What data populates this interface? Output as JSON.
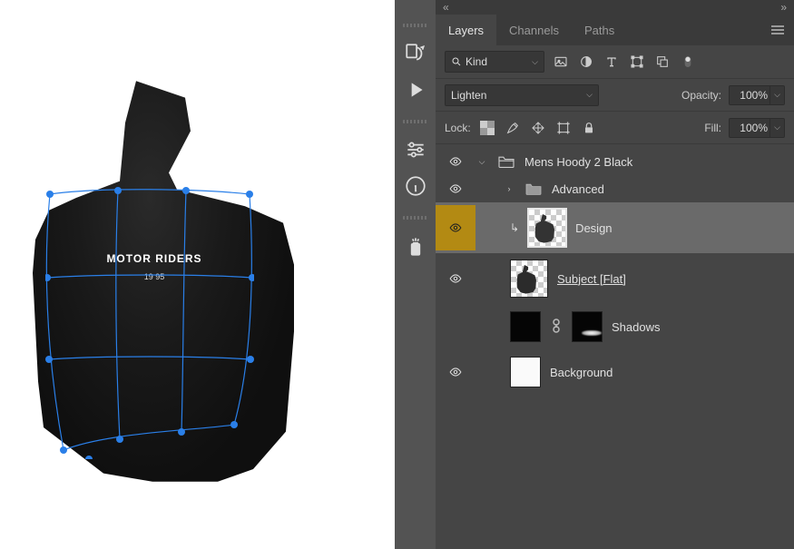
{
  "canvas": {
    "design_headline": "MOTOR RIDERS",
    "design_sub": "19   95"
  },
  "panel": {
    "tabs": [
      "Layers",
      "Channels",
      "Paths"
    ],
    "active_tab": 0,
    "filter": {
      "label": "Kind"
    },
    "blend_mode": "Lighten",
    "opacity_label": "Opacity:",
    "opacity_value": "100%",
    "lock_label": "Lock:",
    "fill_label": "Fill:",
    "fill_value": "100%"
  },
  "layers": {
    "group_name": "Mens Hoody 2 Black",
    "items": [
      {
        "name": "Advanced"
      },
      {
        "name": "Design"
      },
      {
        "name": "Subject [Flat]"
      },
      {
        "name": "Shadows"
      },
      {
        "name": "Background"
      }
    ]
  }
}
